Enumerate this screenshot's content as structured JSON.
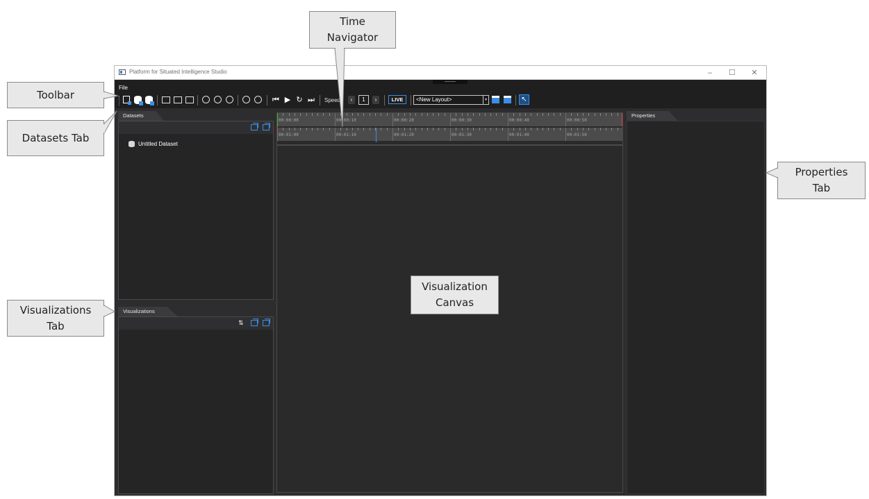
{
  "callouts": {
    "time_navigator": [
      "Time",
      "Navigator"
    ],
    "toolbar": "Toolbar",
    "datasets_tab": "Datasets Tab",
    "visualizations_tab": [
      "Visualizations",
      "Tab"
    ],
    "visualization_canvas": [
      "Visualization",
      "Canvas"
    ],
    "properties_tab": [
      "Properties",
      "Tab"
    ]
  },
  "window": {
    "title": "Platform for Situated Intelligence Studio",
    "controls": {
      "minimize": "–",
      "maximize": "☐",
      "close": "✕"
    }
  },
  "menu": {
    "file": "File"
  },
  "toolbar": {
    "speed_label": "Speed",
    "speed_prev": "‹",
    "speed_value": "1",
    "speed_next": "›",
    "live": "LIVE",
    "layout": "<New Layout>",
    "layout_caret": "▾",
    "playback": {
      "to_start": "⏮",
      "play": "▶",
      "loop": "↻",
      "to_end": "⏭"
    },
    "cursor": "↖"
  },
  "datasets": {
    "tab": "Datasets",
    "items": [
      "Untitled Dataset"
    ]
  },
  "visualizations": {
    "tab": "Visualizations",
    "sort": "⇅"
  },
  "properties": {
    "tab": "Properties"
  },
  "navigator": {
    "top_labels": [
      "00:00:00",
      "00:00:10",
      "00:00:20",
      "00:00:30",
      "00:00:40",
      "00:00:50"
    ],
    "bottom_labels": [
      "00:01:00",
      "00:01:10",
      "00:01:20",
      "00:01:30",
      "00:01:40",
      "00:01:50"
    ]
  },
  "colors": {
    "accent": "#3a8ee6",
    "window_bg": "#2d2d30",
    "callout_bg": "#e8e8e8",
    "range_start": "#3cb043",
    "range_end": "#e03c3c"
  }
}
